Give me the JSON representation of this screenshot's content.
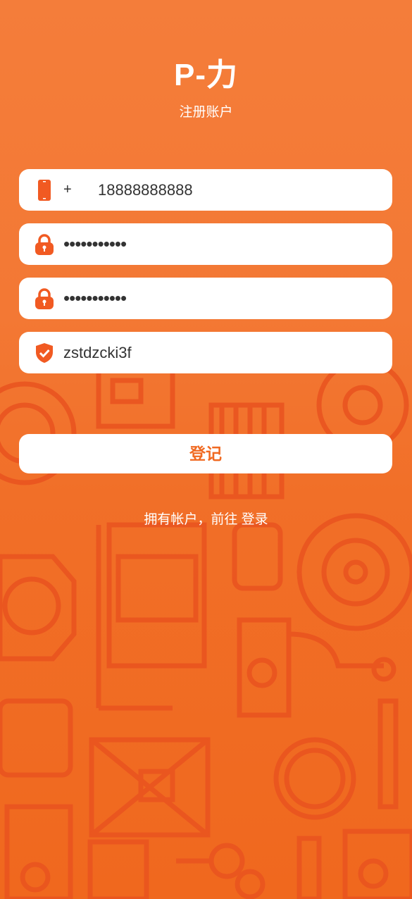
{
  "header": {
    "app_title": "P-力",
    "subtitle": "注册账户"
  },
  "form": {
    "phone": {
      "icon": "phone-icon",
      "prefix": "+",
      "value": "18888888888"
    },
    "password": {
      "icon": "lock-icon",
      "masked_value": "•••••••••••"
    },
    "confirm_password": {
      "icon": "lock-icon",
      "masked_value": "•••••••••••"
    },
    "captcha": {
      "icon": "shield-check-icon",
      "value": "zstdzcki3f"
    },
    "submit_label": "登记"
  },
  "footer": {
    "prompt": "拥有帐户，前往 ",
    "login_link": "登录"
  },
  "colors": {
    "accent": "#f15a22",
    "background": "#f37834",
    "field_bg": "#ffffff",
    "text": "#333333"
  }
}
